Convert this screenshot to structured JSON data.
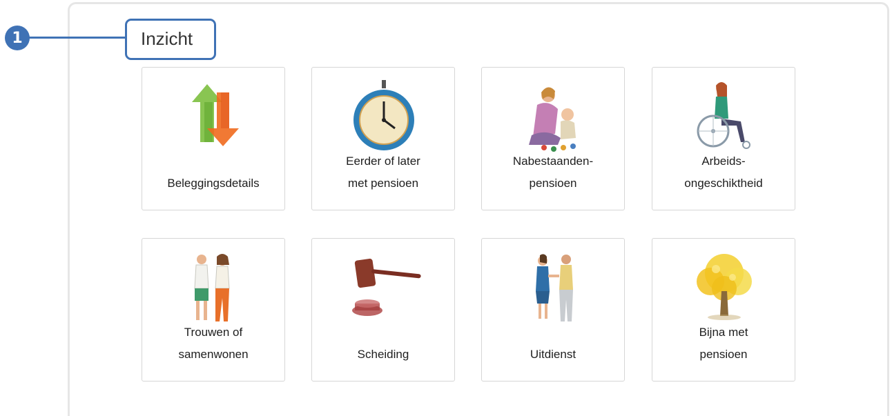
{
  "callout": {
    "number": "1",
    "color": "#3f72b5"
  },
  "section": {
    "title": "Inzicht"
  },
  "tiles": [
    {
      "icon": "arrows-up-down-icon",
      "line1": "",
      "line2": "Beleggingsdetails"
    },
    {
      "icon": "clock-icon",
      "line1": "Eerder of later",
      "line2": "met pensioen"
    },
    {
      "icon": "mother-child-icon",
      "line1": "Nabestaanden-",
      "line2": "pensioen"
    },
    {
      "icon": "wheelchair-icon",
      "line1": "Arbeids-",
      "line2": "ongeschiktheid"
    },
    {
      "icon": "couple-walking-icon",
      "line1": "Trouwen of",
      "line2": "samenwonen"
    },
    {
      "icon": "gavel-icon",
      "line1": "",
      "line2": "Scheiding"
    },
    {
      "icon": "handshake-icon",
      "line1": "",
      "line2": "Uitdienst"
    },
    {
      "icon": "golden-tree-icon",
      "line1": "Bijna met",
      "line2": "pensioen"
    }
  ]
}
